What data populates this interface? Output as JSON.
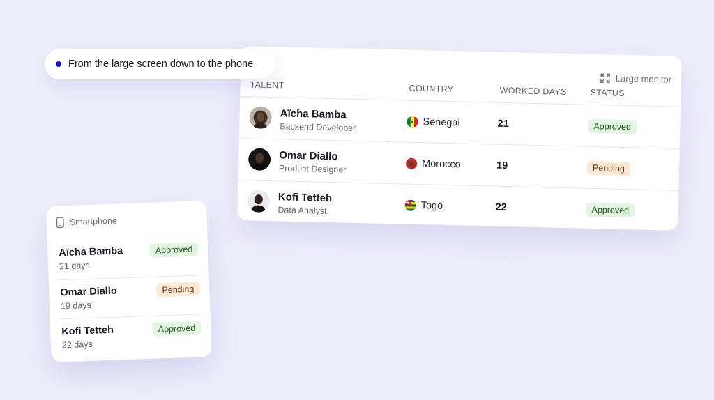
{
  "caption": {
    "text": "From the large screen down to the phone"
  },
  "desktop": {
    "monitor_label": "Large monitor",
    "monitor_icon": "expand-icon",
    "columns": {
      "talent": "TALENT",
      "country": "COUNTRY",
      "worked_days": "WORKED DAYS",
      "status": "STATUS"
    },
    "rows": [
      {
        "name": "Aïcha Bamba",
        "role": "Backend Developer",
        "country": "Senegal",
        "days": "21",
        "status": "Approved"
      },
      {
        "name": "Omar Diallo",
        "role": "Product Designer",
        "country": "Morocco",
        "days": "19",
        "status": "Pending"
      },
      {
        "name": "Kofi Tetteh",
        "role": "Data Analyst",
        "country": "Togo",
        "days": "22",
        "status": "Approved"
      }
    ]
  },
  "phone": {
    "title": "Smartphone",
    "title_icon": "smartphone-icon",
    "items": [
      {
        "name": "Aïcha Bamba",
        "days": "21 days",
        "status": "Approved"
      },
      {
        "name": "Omar Diallo",
        "days": "19 days",
        "status": "Pending"
      },
      {
        "name": "Kofi Tetteh",
        "days": "22 days",
        "status": "Approved"
      }
    ]
  },
  "colors": {
    "background": "#EEEDFB",
    "accent_dot": "#1414E0",
    "approved_bg": "#E3F6E2",
    "approved_text": "#1f5a1f",
    "pending_bg": "#FBE9D6",
    "pending_text": "#6b3a12"
  }
}
